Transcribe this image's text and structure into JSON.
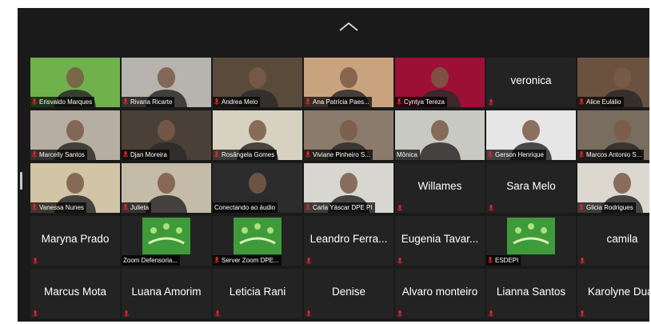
{
  "ui": {
    "colors": {
      "background": "#1a1a1a",
      "tile": "#232323",
      "label_text": "#ffffff",
      "muted_mic": "#e0262a",
      "active_speaker": "#c9e33a"
    },
    "controls": {
      "collapse_icon": "chevron-up-icon"
    }
  },
  "gallery": {
    "participants": [
      {
        "name": "Erisvaldo Marques",
        "video": true,
        "muted": true,
        "bg": "#6fb24c"
      },
      {
        "name": "Rivana Ricarte",
        "video": true,
        "muted": true,
        "bg": "#b7b3ae"
      },
      {
        "name": "Andrea Melo",
        "video": true,
        "muted": true,
        "bg": "#5a4a3a"
      },
      {
        "name": "Ana Patrícia Paes...",
        "video": true,
        "muted": true,
        "bg": "#c9a27e"
      },
      {
        "name": "Cyntya Tereza",
        "video": true,
        "muted": true,
        "bg": "#9c1035"
      },
      {
        "name": "veronica",
        "video": false,
        "muted": true
      },
      {
        "name": "Alice Eulálio",
        "video": true,
        "muted": true,
        "bg": "#6b5240"
      },
      {
        "name": "Marcelly Santos",
        "video": true,
        "muted": true,
        "bg": "#b6aea2"
      },
      {
        "name": "Djan Moreira",
        "video": true,
        "muted": true,
        "bg": "#4a4038"
      },
      {
        "name": "Rosângela Gomes",
        "video": true,
        "muted": true,
        "bg": "#d7d2c0",
        "active": true
      },
      {
        "name": "Viviane Pinheiro S...",
        "video": true,
        "muted": true,
        "bg": "#8a7b6d"
      },
      {
        "name": "Mônica",
        "video": true,
        "muted": false,
        "bg": "#c9c9c4"
      },
      {
        "name": "Gerson Henrique",
        "video": true,
        "muted": true,
        "bg": "#e6e6e6"
      },
      {
        "name": "Marcos Antonio S...",
        "video": true,
        "muted": true,
        "bg": "#786d5e"
      },
      {
        "name": "Vanessa Nunes",
        "video": true,
        "muted": true,
        "bg": "#d2c4a6"
      },
      {
        "name": "Julieta",
        "video": true,
        "muted": true,
        "bg": "#c4bba8"
      },
      {
        "name": "Conectando ao áudio",
        "video": true,
        "muted": false,
        "bg": "#2c2c2c"
      },
      {
        "name": "Carla Yáscar DPE PI",
        "video": true,
        "muted": true,
        "bg": "#d8d6d0"
      },
      {
        "name": "Willames",
        "video": false,
        "muted": true
      },
      {
        "name": "Sara Melo",
        "video": false,
        "muted": true
      },
      {
        "name": "Glicia Rodrigues",
        "video": true,
        "muted": true,
        "bg": "#dcd7cf"
      },
      {
        "name": "Maryna Prado",
        "video": false,
        "muted": true
      },
      {
        "name": "Zoom Defensoria...",
        "video": true,
        "muted": false,
        "bg": "#1e1e1e",
        "logo": true
      },
      {
        "name": "Server Zoom DPE...",
        "video": true,
        "muted": true,
        "bg": "#1e1e1e",
        "logo": true
      },
      {
        "name": "Leandro Ferra...",
        "video": false,
        "muted": true
      },
      {
        "name": "Eugenia Tavar...",
        "video": false,
        "muted": true
      },
      {
        "name": "ESDEPI",
        "video": true,
        "muted": true,
        "bg": "#1e1e1e",
        "logo": true
      },
      {
        "name": "camila",
        "video": false,
        "muted": true
      },
      {
        "name": "Marcus Mota",
        "video": false,
        "muted": true
      },
      {
        "name": "Luana Amorim",
        "video": false,
        "muted": true
      },
      {
        "name": "Leticia Rani",
        "video": false,
        "muted": true
      },
      {
        "name": "Denise",
        "video": false,
        "muted": true
      },
      {
        "name": "Alvaro monteiro",
        "video": false,
        "muted": true
      },
      {
        "name": "Lianna Santos",
        "video": false,
        "muted": true
      },
      {
        "name": "Karolyne Duar",
        "video": false,
        "muted": true
      }
    ]
  }
}
